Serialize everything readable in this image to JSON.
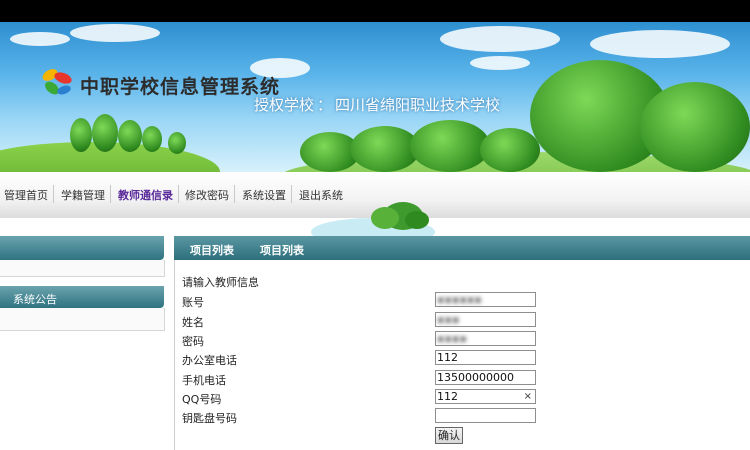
{
  "header": {
    "system_title": "中职学校信息管理系统",
    "licensed_label": "授权学校",
    "separator": "：",
    "school_name": "四川省绵阳职业技术学校"
  },
  "nav": {
    "items": [
      {
        "label": "管理首页",
        "active": false
      },
      {
        "label": "学籍管理",
        "active": false
      },
      {
        "label": "教师通信录",
        "active": true
      },
      {
        "label": "修改密码",
        "active": false
      },
      {
        "label": "系统设置",
        "active": false
      },
      {
        "label": "退出系统",
        "active": false
      }
    ]
  },
  "sidebar": {
    "announcement_title": "系统公告"
  },
  "tabs": [
    "项目列表",
    "项目列表"
  ],
  "form": {
    "heading": "请输入教师信息",
    "fields": [
      {
        "label": "账号",
        "value": "▪▪▪▪▪▪"
      },
      {
        "label": "姓名",
        "value": "▪▪▪"
      },
      {
        "label": "密码",
        "value": "▪▪▪▪"
      },
      {
        "label": "办公室电话",
        "value": "112"
      },
      {
        "label": "手机电话",
        "value": "13500000000"
      },
      {
        "label": "QQ号码",
        "value": "112"
      },
      {
        "label": "钥匙盘号码",
        "value": ""
      }
    ],
    "clear_glyph": "×",
    "submit_label": "确认"
  }
}
